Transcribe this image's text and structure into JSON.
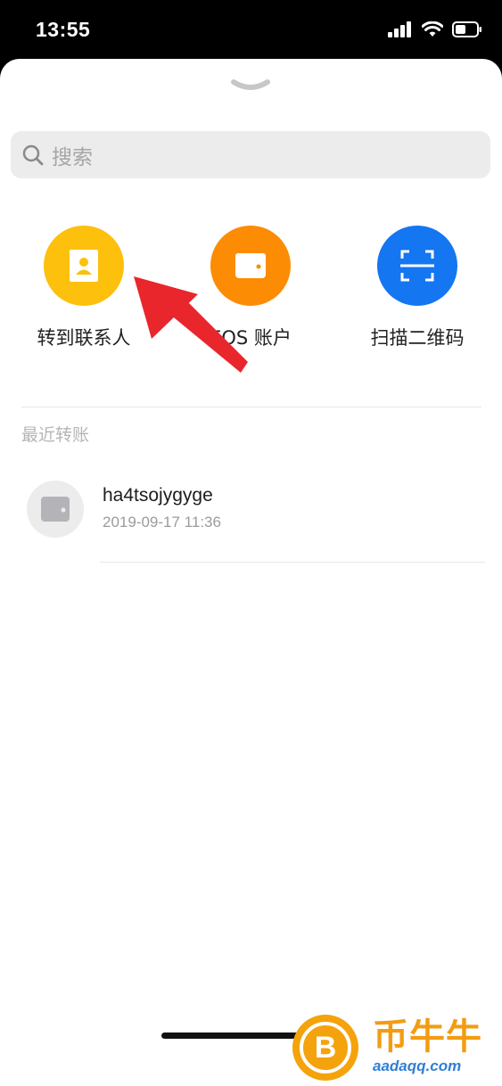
{
  "status_bar": {
    "time": "13:55",
    "icons": [
      "signal-icon",
      "wifi-icon",
      "battery-icon"
    ]
  },
  "search": {
    "placeholder": "搜索"
  },
  "actions": [
    {
      "label": "转到联系人",
      "icon": "contact-card-icon",
      "color": "#fcc00d"
    },
    {
      "label": "EOS 账户",
      "icon": "wallet-icon",
      "color": "#fc8c04"
    },
    {
      "label": "扫描二维码",
      "icon": "qr-scan-icon",
      "color": "#1476f1"
    }
  ],
  "recent": {
    "title": "最近转账",
    "items": [
      {
        "name": "ha4tsojygyge",
        "time": "2019-09-17 11:36",
        "icon": "wallet-icon"
      }
    ]
  },
  "annotation": {
    "arrow_color": "#e8262c"
  },
  "watermark": {
    "coin_symbol": "B",
    "brand": "币牛牛",
    "site": "aadaqq.com"
  }
}
